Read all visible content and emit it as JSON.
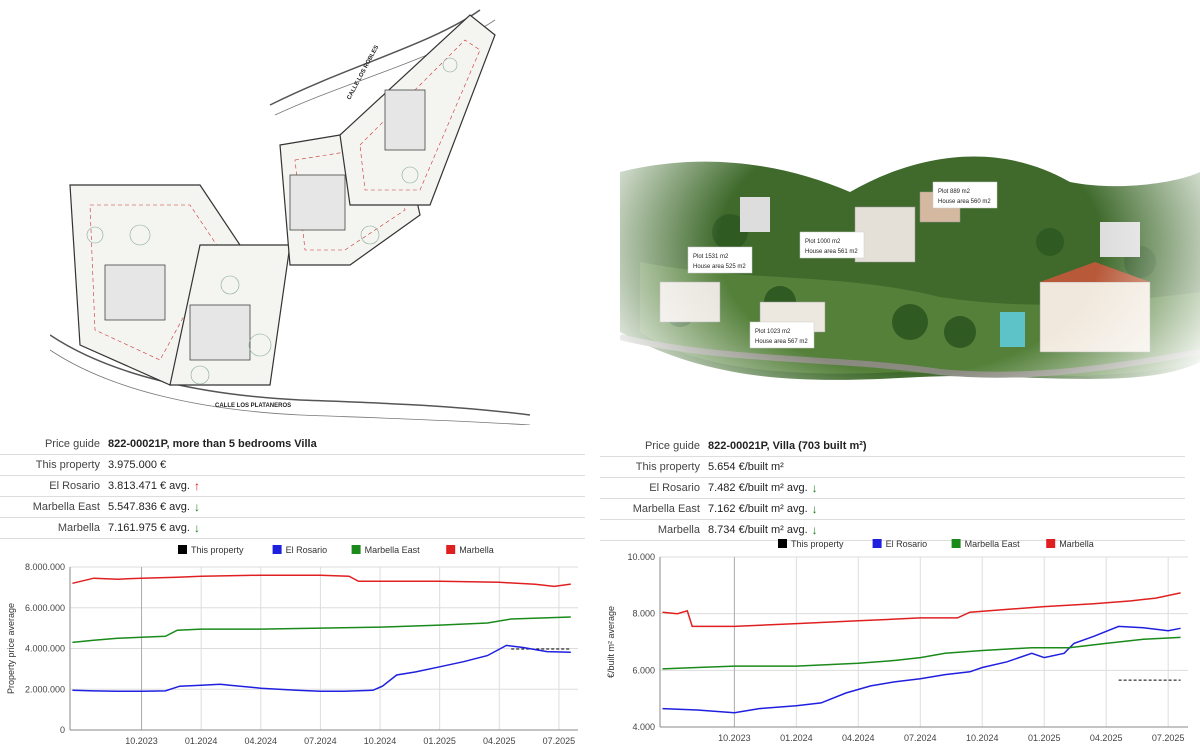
{
  "left": {
    "plan": {
      "street_top": "CALLE LOS ROBLES",
      "street_bottom": "CALLE LOS PLATANEROS"
    },
    "price_guide": {
      "rows": [
        {
          "label": "Price guide",
          "value": "822-00021P, more than 5 bedrooms Villa",
          "bold": true,
          "arrow": ""
        },
        {
          "label": "This property",
          "value": "3.975.000 €",
          "bold": false,
          "arrow": ""
        },
        {
          "label": "El Rosario",
          "value": "3.813.471 € avg.",
          "bold": false,
          "arrow": "up"
        },
        {
          "label": "Marbella East",
          "value": "5.547.836 € avg.",
          "bold": false,
          "arrow": "down"
        },
        {
          "label": "Marbella",
          "value": "7.161.975 € avg.",
          "bold": false,
          "arrow": "down"
        }
      ]
    }
  },
  "right": {
    "render": {
      "labels": [
        {
          "plot": "Plot 889 m2",
          "house": "House area 560 m2"
        },
        {
          "plot": "Plot 1000 m2",
          "house": "House area 561 m2"
        },
        {
          "plot": "Plot 1531 m2",
          "house": "House area 525 m2"
        },
        {
          "plot": "Plot 1023 m2",
          "house": "House area 567 m2"
        }
      ]
    },
    "price_guide": {
      "rows": [
        {
          "label": "Price guide",
          "value": "822-00021P, Villa (703 built m²)",
          "bold": true,
          "arrow": ""
        },
        {
          "label": "This property",
          "value": "5.654 €/built m²",
          "bold": false,
          "arrow": ""
        },
        {
          "label": "El Rosario",
          "value": "7.482 €/built m² avg.",
          "bold": false,
          "arrow": "down"
        },
        {
          "label": "Marbella East",
          "value": "7.162 €/built m² avg.",
          "bold": false,
          "arrow": "down"
        },
        {
          "label": "Marbella",
          "value": "8.734 €/built m² avg.",
          "bold": false,
          "arrow": "down"
        }
      ]
    }
  },
  "colors": {
    "this_property": "#000000",
    "el_rosario": "#1f1fe0",
    "marbella_east": "#1a8a1a",
    "marbella": "#e02020",
    "up_arrow": "#d01010",
    "down_arrow": "#1a7a1a"
  },
  "chart_data": [
    {
      "type": "line",
      "title": "",
      "xlabel": "",
      "ylabel": "Property price average",
      "ylim": [
        0,
        8000000
      ],
      "yticks": [
        0,
        2000000,
        4000000,
        6000000,
        8000000
      ],
      "ytick_labels": [
        "0",
        "2.000.000",
        "4.000.000",
        "6.000.000",
        "8.000.000"
      ],
      "xlim": [
        2023.45,
        2025.58
      ],
      "xticks": [
        2023.75,
        2024.0,
        2024.25,
        2024.5,
        2024.75,
        2025.0,
        2025.25,
        2025.5
      ],
      "xtick_labels": [
        "10.2023",
        "01.2024",
        "04.2024",
        "07.2024",
        "10.2024",
        "01.2025",
        "04.2025",
        "07.2025"
      ],
      "grid": true,
      "legend_position": "top",
      "series": [
        {
          "name": "This property",
          "color_key": "this_property",
          "dashed": true,
          "points": [
            [
              2025.3,
              3975000
            ],
            [
              2025.55,
              3975000
            ]
          ]
        },
        {
          "name": "El Rosario",
          "color_key": "el_rosario",
          "dashed": false,
          "points": [
            [
              2023.46,
              1950000
            ],
            [
              2023.55,
              1920000
            ],
            [
              2023.65,
              1900000
            ],
            [
              2023.75,
              1900000
            ],
            [
              2023.85,
              1920000
            ],
            [
              2023.91,
              2150000
            ],
            [
              2024.0,
              2200000
            ],
            [
              2024.08,
              2250000
            ],
            [
              2024.12,
              2200000
            ],
            [
              2024.25,
              2050000
            ],
            [
              2024.4,
              1950000
            ],
            [
              2024.5,
              1900000
            ],
            [
              2024.6,
              1900000
            ],
            [
              2024.72,
              1950000
            ],
            [
              2024.76,
              2150000
            ],
            [
              2024.82,
              2700000
            ],
            [
              2024.9,
              2850000
            ],
            [
              2025.0,
              3100000
            ],
            [
              2025.1,
              3350000
            ],
            [
              2025.2,
              3650000
            ],
            [
              2025.28,
              4150000
            ],
            [
              2025.35,
              4050000
            ],
            [
              2025.45,
              3850000
            ],
            [
              2025.55,
              3813471
            ]
          ]
        },
        {
          "name": "Marbella East",
          "color_key": "marbella_east",
          "dashed": false,
          "points": [
            [
              2023.46,
              4300000
            ],
            [
              2023.55,
              4400000
            ],
            [
              2023.65,
              4500000
            ],
            [
              2023.75,
              4550000
            ],
            [
              2023.85,
              4600000
            ],
            [
              2023.9,
              4900000
            ],
            [
              2024.0,
              4950000
            ],
            [
              2024.25,
              4950000
            ],
            [
              2024.5,
              5000000
            ],
            [
              2024.75,
              5050000
            ],
            [
              2025.0,
              5150000
            ],
            [
              2025.2,
              5250000
            ],
            [
              2025.3,
              5450000
            ],
            [
              2025.55,
              5547836
            ]
          ]
        },
        {
          "name": "Marbella",
          "color_key": "marbella",
          "dashed": false,
          "points": [
            [
              2023.46,
              7200000
            ],
            [
              2023.55,
              7450000
            ],
            [
              2023.65,
              7400000
            ],
            [
              2023.75,
              7450000
            ],
            [
              2023.9,
              7500000
            ],
            [
              2024.0,
              7550000
            ],
            [
              2024.25,
              7600000
            ],
            [
              2024.5,
              7600000
            ],
            [
              2024.62,
              7550000
            ],
            [
              2024.66,
              7300000
            ],
            [
              2024.75,
              7300000
            ],
            [
              2025.0,
              7300000
            ],
            [
              2025.25,
              7250000
            ],
            [
              2025.4,
              7150000
            ],
            [
              2025.48,
              7050000
            ],
            [
              2025.55,
              7161975
            ]
          ]
        }
      ]
    },
    {
      "type": "line",
      "title": "",
      "xlabel": "",
      "ylabel": "€/built m² average",
      "ylim": [
        4000,
        10000
      ],
      "yticks": [
        4000,
        6000,
        8000,
        10000
      ],
      "ytick_labels": [
        "4.000",
        "6.000",
        "8.000",
        "10.000"
      ],
      "xlim": [
        2023.45,
        2025.58
      ],
      "xticks": [
        2023.75,
        2024.0,
        2024.25,
        2024.5,
        2024.75,
        2025.0,
        2025.25,
        2025.5
      ],
      "xtick_labels": [
        "10.2023",
        "01.2024",
        "04.2024",
        "07.2024",
        "10.2024",
        "01.2025",
        "04.2025",
        "07.2025"
      ],
      "grid": true,
      "legend_position": "top",
      "series": [
        {
          "name": "This property",
          "color_key": "this_property",
          "dashed": true,
          "points": [
            [
              2025.3,
              5654
            ],
            [
              2025.55,
              5654
            ]
          ]
        },
        {
          "name": "El Rosario",
          "color_key": "el_rosario",
          "dashed": false,
          "points": [
            [
              2023.46,
              4650
            ],
            [
              2023.6,
              4600
            ],
            [
              2023.75,
              4500
            ],
            [
              2023.85,
              4650
            ],
            [
              2024.0,
              4750
            ],
            [
              2024.1,
              4850
            ],
            [
              2024.2,
              5200
            ],
            [
              2024.3,
              5450
            ],
            [
              2024.4,
              5600
            ],
            [
              2024.5,
              5700
            ],
            [
              2024.6,
              5850
            ],
            [
              2024.7,
              5950
            ],
            [
              2024.75,
              6100
            ],
            [
              2024.85,
              6300
            ],
            [
              2024.95,
              6600
            ],
            [
              2025.0,
              6450
            ],
            [
              2025.08,
              6600
            ],
            [
              2025.12,
              6950
            ],
            [
              2025.2,
              7200
            ],
            [
              2025.3,
              7550
            ],
            [
              2025.4,
              7500
            ],
            [
              2025.5,
              7400
            ],
            [
              2025.55,
              7482
            ]
          ]
        },
        {
          "name": "Marbella East",
          "color_key": "marbella_east",
          "dashed": false,
          "points": [
            [
              2023.46,
              6050
            ],
            [
              2023.6,
              6100
            ],
            [
              2023.75,
              6150
            ],
            [
              2024.0,
              6150
            ],
            [
              2024.25,
              6250
            ],
            [
              2024.4,
              6350
            ],
            [
              2024.5,
              6450
            ],
            [
              2024.6,
              6600
            ],
            [
              2024.75,
              6700
            ],
            [
              2024.95,
              6800
            ],
            [
              2025.1,
              6800
            ],
            [
              2025.25,
              6950
            ],
            [
              2025.4,
              7100
            ],
            [
              2025.55,
              7162
            ]
          ]
        },
        {
          "name": "Marbella",
          "color_key": "marbella",
          "dashed": false,
          "points": [
            [
              2023.46,
              8050
            ],
            [
              2023.52,
              8000
            ],
            [
              2023.56,
              8100
            ],
            [
              2023.58,
              7550
            ],
            [
              2023.75,
              7550
            ],
            [
              2024.0,
              7650
            ],
            [
              2024.25,
              7750
            ],
            [
              2024.5,
              7850
            ],
            [
              2024.65,
              7850
            ],
            [
              2024.7,
              8050
            ],
            [
              2024.85,
              8150
            ],
            [
              2025.0,
              8250
            ],
            [
              2025.2,
              8350
            ],
            [
              2025.35,
              8450
            ],
            [
              2025.45,
              8550
            ],
            [
              2025.55,
              8734
            ]
          ]
        }
      ]
    }
  ]
}
